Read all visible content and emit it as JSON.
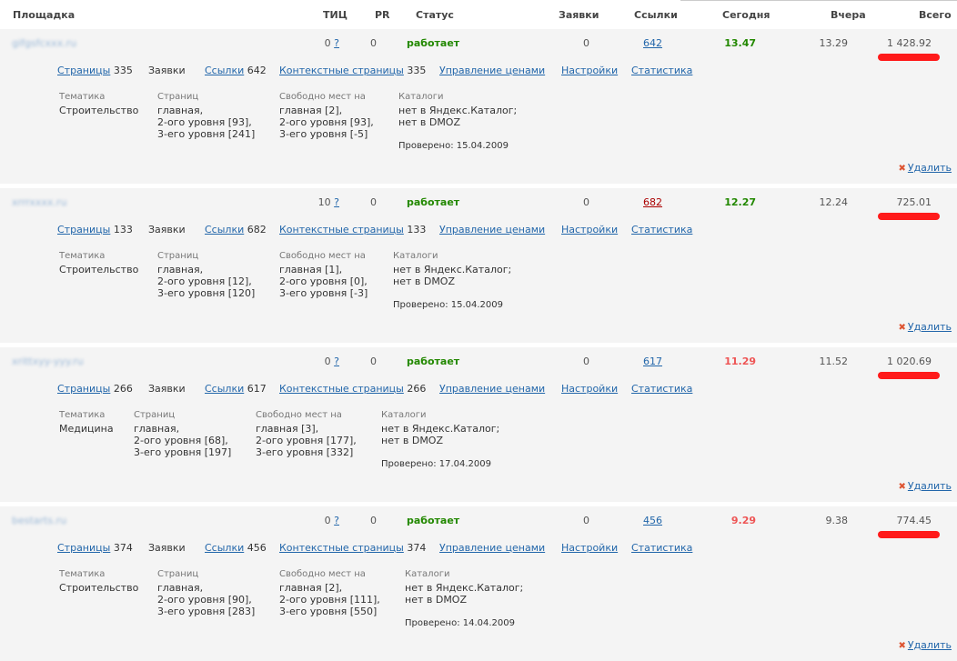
{
  "header": {
    "site": "Площадка",
    "tic": "ТИЦ",
    "pr": "PR",
    "status": "Статус",
    "requests": "Заявки",
    "links": "Ссылки",
    "today": "Сегодня",
    "yesterday": "Вчера",
    "total": "Всего"
  },
  "labels": {
    "pages": "Страницы",
    "requests": "Заявки",
    "links": "Ссылки",
    "context_pages": "Контекстные страницы",
    "price_mgmt": "Управление ценами",
    "settings": "Настройки",
    "stats": "Статистика",
    "topic": "Тематика",
    "pages_col": "Страниц",
    "free_places": "Свободно мест на",
    "catalogs": "Каталоги",
    "help_mark": "?",
    "delete": "Удалить",
    "delete_icon": "✖"
  },
  "colors": {
    "link": "#2266aa",
    "status_green": "#228800",
    "today_red": "#ee5555",
    "card_bg": "#f4f4f4",
    "redaction": "#ff1a1a"
  },
  "sites": [
    {
      "name": "gifgsfcxxx.ru",
      "tic": "0",
      "pr": "0",
      "status": "работает",
      "requests": "0",
      "links": "642",
      "links_style": "normal",
      "today": "13.47",
      "today_style": "green",
      "yesterday": "13.29",
      "total": "1 428.92",
      "pages_count": "335",
      "links_count": "642",
      "context_count": "335",
      "topic": "Строительство",
      "pages_info": "главная,\n2-ого уровня [93],\n3-его уровня [241]",
      "free_info": "главная [2],\n2-ого уровня [93],\n3-его уровня [-5]",
      "catalogs_info": "нет в Яндекс.Каталог;\nнет в DMOZ",
      "checked": "Проверено: 15.04.2009"
    },
    {
      "name": "xrrrxxxx.ru",
      "tic": "10",
      "pr": "0",
      "status": "работает",
      "requests": "0",
      "links": "682",
      "links_style": "red",
      "today": "12.27",
      "today_style": "green",
      "yesterday": "12.24",
      "total": "725.01",
      "pages_count": "133",
      "links_count": "682",
      "context_count": "133",
      "topic": "Строительство",
      "pages_info": "главная,\n2-ого уровня [12],\n3-его уровня [120]",
      "free_info": "главная [1],\n2-ого уровня [0],\n3-его уровня [-3]",
      "catalogs_info": "нет в Яндекс.Каталог;\nнет в DMOZ",
      "checked": "Проверено: 15.04.2009"
    },
    {
      "name": "xrittxyy-yyy.ru",
      "tic": "0",
      "pr": "0",
      "status": "работает",
      "requests": "0",
      "links": "617",
      "links_style": "normal",
      "today": "11.29",
      "today_style": "red",
      "yesterday": "11.52",
      "total": "1 020.69",
      "pages_count": "266",
      "links_count": "617",
      "context_count": "266",
      "topic": "Медицина",
      "pages_info": "главная,\n2-ого уровня [68],\n3-его уровня [197]",
      "free_info": "главная [3],\n2-ого уровня [177],\n3-его уровня [332]",
      "catalogs_info": "нет в Яндекс.Каталог;\nнет в DMOZ",
      "checked": "Проверено: 17.04.2009"
    },
    {
      "name": "bestarts.ru",
      "tic": "0",
      "pr": "0",
      "status": "работает",
      "requests": "0",
      "links": "456",
      "links_style": "normal",
      "today": "9.29",
      "today_style": "red",
      "yesterday": "9.38",
      "total": "774.45",
      "pages_count": "374",
      "links_count": "456",
      "context_count": "374",
      "topic": "Строительство",
      "pages_info": "главная,\n2-ого уровня [90],\n3-его уровня [283]",
      "free_info": "главная [2],\n2-ого уровня [111],\n3-его уровня [550]",
      "catalogs_info": "нет в Яндекс.Каталог;\nнет в DMOZ",
      "checked": "Проверено: 14.04.2009"
    }
  ]
}
